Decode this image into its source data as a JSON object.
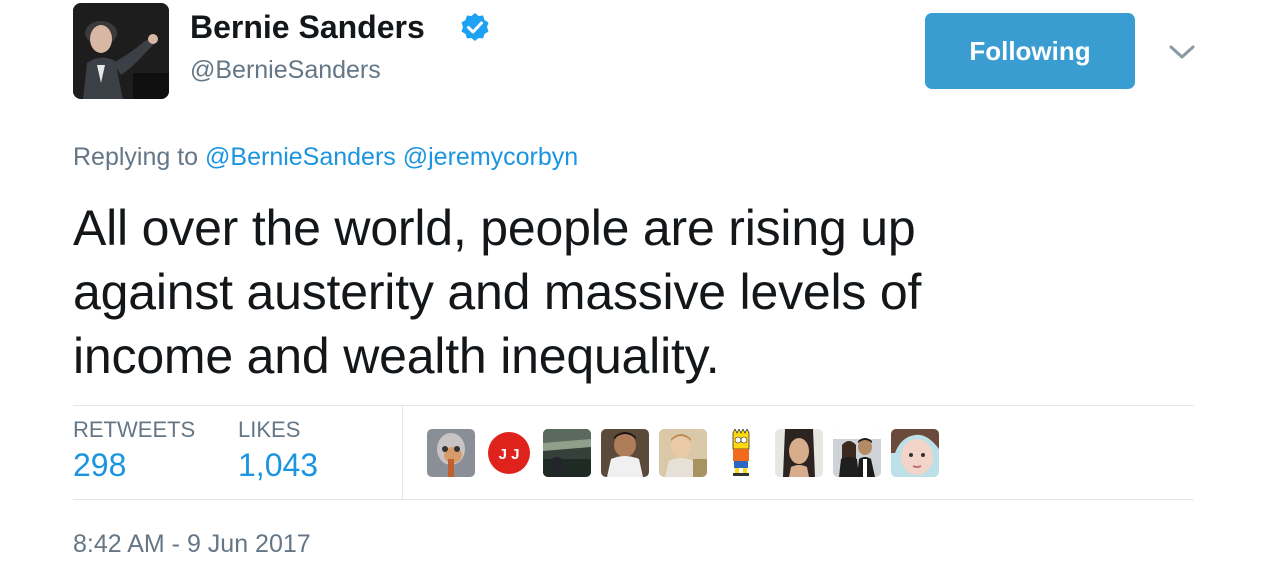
{
  "author": {
    "name": "Bernie Sanders",
    "handle": "@BernieSanders",
    "avatar_icon": "avatar-photo",
    "verified_icon": "verified-badge-icon"
  },
  "follow_button": {
    "label": "Following"
  },
  "reply": {
    "prefix": "Replying to ",
    "mention1": "@BernieSanders",
    "separator": " ",
    "mention2": "@jeremycorbyn"
  },
  "tweet": {
    "lines": [
      "All over the world, people are rising up",
      "against austerity and massive levels of",
      "income and wealth inequality."
    ]
  },
  "stats": {
    "retweets_label": "RETWEETS",
    "retweets_value": "298",
    "likes_label": "LIKES",
    "likes_value": "1,043"
  },
  "liker_avatars": [
    "liker-avatar-1",
    "liker-avatar-2",
    "liker-avatar-3",
    "liker-avatar-4",
    "liker-avatar-5",
    "liker-avatar-6",
    "liker-avatar-7",
    "liker-avatar-8",
    "liker-avatar-9"
  ],
  "liker_badge_text": "J J",
  "timestamp": "8:42 AM - 9 Jun 2017",
  "colors": {
    "accent": "#1b95e0",
    "follow_button_bg": "#3a9dd2",
    "secondary_text": "#657786",
    "divider": "#e1e8ed"
  }
}
